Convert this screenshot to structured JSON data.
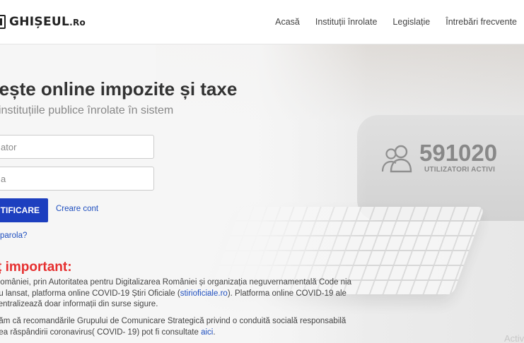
{
  "header": {
    "logo_text": "GHIȘEUL",
    "logo_suffix": ".Ro",
    "nav": [
      "Acasă",
      "Instituții înrolate",
      "Legislație",
      "Întrebări frecvente"
    ]
  },
  "hero": {
    "title": "tește online impozite și taxe",
    "subtitle": "instituțiile publice înrolate în sistem",
    "username_placeholder": "ator",
    "password_placeholder": "a",
    "login_button": "NTIFICARE",
    "create_account": "Creare cont",
    "forgot_password": "parola?"
  },
  "stats": {
    "count": "591020",
    "label": "UTILIZATORI ACTIVI"
  },
  "notice": {
    "title": "ț important:",
    "p1_before": " României, prin Autoritatea pentru Digitalizarea României și organizația neguvernamentală Code nia au lansat, platforma online COVID-19 Știri Oficiale (",
    "p1_link": "stirioficiale.ro",
    "p1_after": "). Platforma online COVID-19 ale centralizează doar informații din surse sigure.",
    "p2_before": "năm că recomandările Grupului de Comunicare Strategică privind o conduită socială responsabilă irea răspândirii coronavirus( COVID- 19) pot fi consultate ",
    "p2_link": "aici",
    "p2_after": "."
  },
  "watermark": "Activ"
}
